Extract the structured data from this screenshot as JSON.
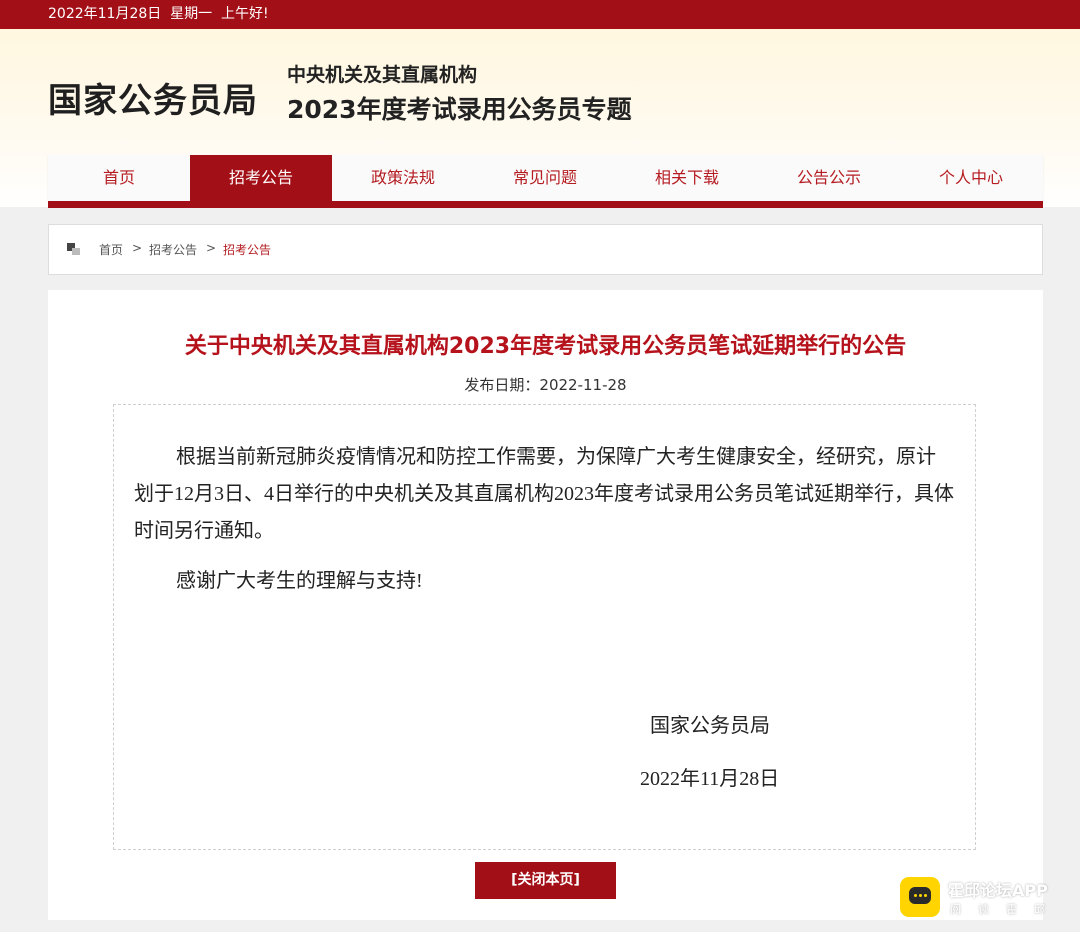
{
  "topbar": {
    "date_greeting": "2022年11月28日  星期一  上午好!"
  },
  "header": {
    "logo": "国家公务员局",
    "subtitle_line1": "中央机关及其直属机构",
    "subtitle_line2": "2023年度考试录用公务员专题"
  },
  "nav": {
    "items": [
      {
        "label": "首页"
      },
      {
        "label": "招考公告"
      },
      {
        "label": "政策法规"
      },
      {
        "label": "常见问题"
      },
      {
        "label": "相关下载"
      },
      {
        "label": "公告公示"
      },
      {
        "label": "个人中心"
      }
    ],
    "active_index": 1
  },
  "breadcrumb": {
    "home": "首页",
    "separator": ">",
    "section": "招考公告",
    "current": "招考公告"
  },
  "article": {
    "title": "关于中央机关及其直属机构2023年度考试录用公务员笔试延期举行的公告",
    "publish_date": "发布日期：2022-11-28",
    "paragraph1": "根据当前新冠肺炎疫情情况和防控工作需要，为保障广大考生健康安全，经研究，原计划于12月3日、4日举行的中央机关及其直属机构2023年度考试录用公务员笔试延期举行，具体时间另行通知。",
    "paragraph2": "感谢广大考生的理解与支持!",
    "signature_org": "国家公务员局",
    "signature_date": "2022年11月28日"
  },
  "close_button": "[关闭本页]",
  "watermark": {
    "title": "霍邱论坛APP",
    "subtitle": "阅读霍邱"
  },
  "colors": {
    "brand_red": "#a30f16",
    "title_red": "#b5121b",
    "watermark_yellow": "#ffd400"
  },
  "icons": {
    "breadcrumb": "home-squares-icon",
    "watermark": "chat-bubble-icon"
  }
}
